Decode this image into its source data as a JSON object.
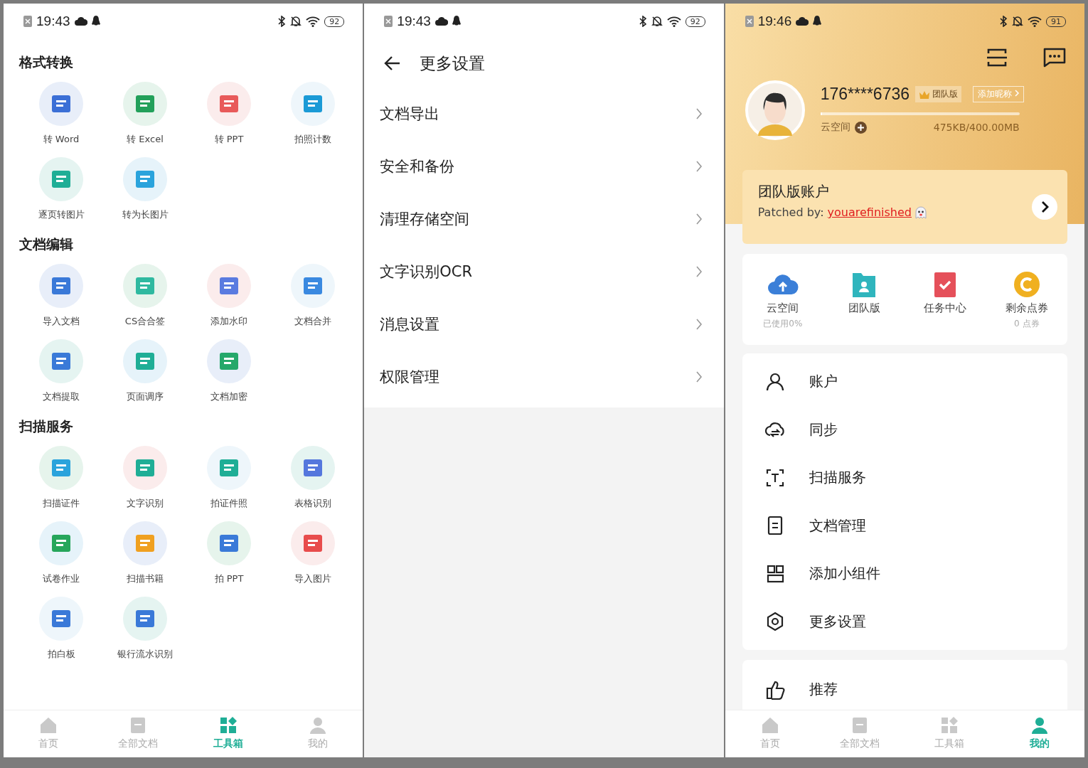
{
  "screens": [
    {
      "status": {
        "time": "19:43",
        "battery": "92"
      },
      "sections": [
        {
          "title": "格式转换",
          "tools": [
            {
              "label": "转 Word"
            },
            {
              "label": "转 Excel"
            },
            {
              "label": "转 PPT"
            },
            {
              "label": "拍照计数"
            },
            {
              "label": "逐页转图片"
            },
            {
              "label": "转为长图片"
            }
          ]
        },
        {
          "title": "文档编辑",
          "tools": [
            {
              "label": "导入文档"
            },
            {
              "label": "CS合合签"
            },
            {
              "label": "添加水印"
            },
            {
              "label": "文档合并"
            },
            {
              "label": "文档提取"
            },
            {
              "label": "页面调序"
            },
            {
              "label": "文档加密"
            }
          ]
        },
        {
          "title": "扫描服务",
          "tools": [
            {
              "label": "扫描证件"
            },
            {
              "label": "文字识别"
            },
            {
              "label": "拍证件照"
            },
            {
              "label": "表格识别"
            },
            {
              "label": "试卷作业"
            },
            {
              "label": "扫描书籍"
            },
            {
              "label": "拍 PPT"
            },
            {
              "label": "导入图片"
            },
            {
              "label": "拍白板"
            },
            {
              "label": "银行流水识别"
            }
          ]
        }
      ],
      "nav": [
        {
          "label": "首页",
          "selected": false
        },
        {
          "label": "全部文档",
          "selected": false
        },
        {
          "label": "工具箱",
          "selected": true
        },
        {
          "label": "我的",
          "selected": false
        }
      ]
    },
    {
      "status": {
        "time": "19:43",
        "battery": "92"
      },
      "title": "更多设置",
      "items": [
        {
          "label": "文档导出"
        },
        {
          "label": "安全和备份"
        },
        {
          "label": "清理存储空间"
        },
        {
          "label": "文字识别OCR"
        },
        {
          "label": "消息设置"
        },
        {
          "label": "权限管理"
        }
      ]
    },
    {
      "status": {
        "time": "19:46",
        "battery": "91"
      },
      "profile": {
        "phone": "176****6736",
        "badge": "团队版",
        "nickname_button": "添加昵称",
        "storage_label": "云空间",
        "storage_text": "475KB/400.00MB",
        "level": 0.01
      },
      "team_card": {
        "title": "团队版账户",
        "prefix": "Patched by:",
        "link": "youarefinished"
      },
      "quick": [
        {
          "label": "云空间",
          "sub": "已使用0%"
        },
        {
          "label": "团队版"
        },
        {
          "label": "任务中心"
        },
        {
          "label": "剩余点券",
          "sub": "0 点券"
        }
      ],
      "menu": [
        {
          "label": "账户"
        },
        {
          "label": "同步"
        },
        {
          "label": "扫描服务"
        },
        {
          "label": "文档管理"
        },
        {
          "label": "添加小组件"
        },
        {
          "label": "更多设置"
        }
      ],
      "extra": [
        {
          "label": "推荐"
        }
      ],
      "nav": [
        {
          "label": "首页",
          "selected": false
        },
        {
          "label": "全部文档",
          "selected": false
        },
        {
          "label": "工具箱",
          "selected": false
        },
        {
          "label": "我的",
          "selected": true
        }
      ]
    }
  ]
}
